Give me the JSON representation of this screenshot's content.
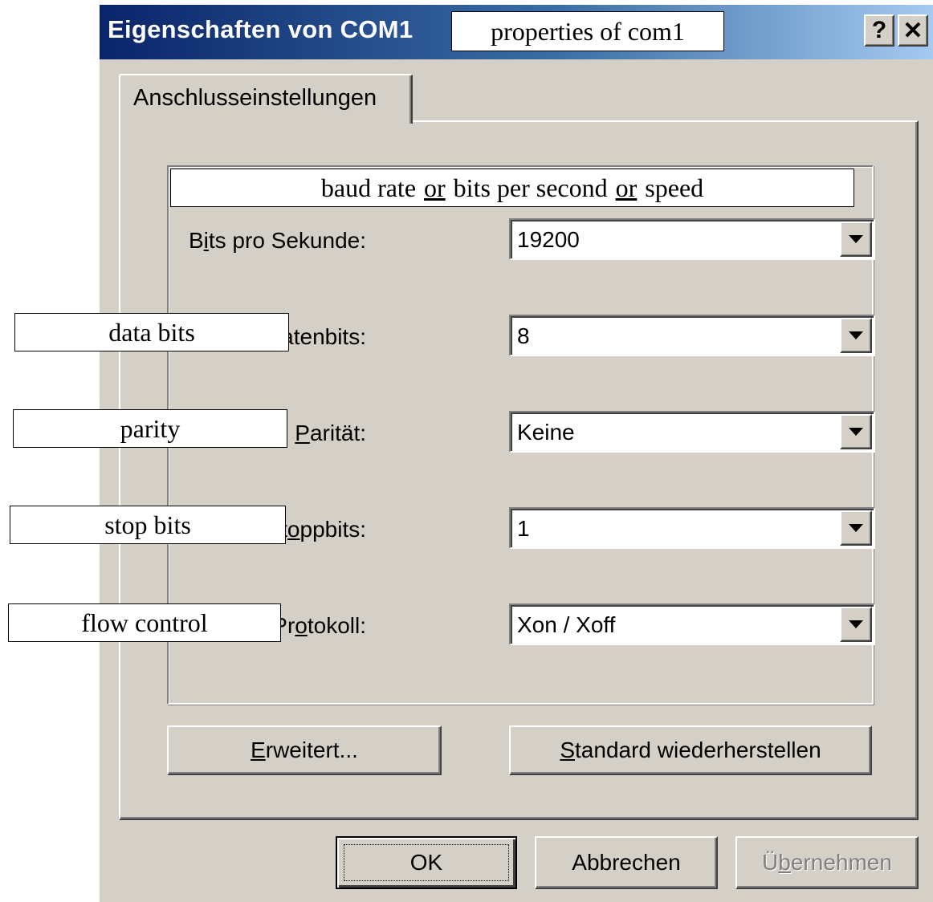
{
  "dialog": {
    "title": "Eigenschaften von COM1",
    "help_button": "?",
    "close_button": "✕",
    "tab_label": "Anschlusseinstellungen"
  },
  "fields": [
    {
      "label_pre": "B",
      "label_key": "i",
      "label_post": "ts pro Sekunde:",
      "value": "19200"
    },
    {
      "label_pre": "",
      "label_key": "D",
      "label_post": "atenbits:",
      "value": "8"
    },
    {
      "label_pre": "",
      "label_key": "P",
      "label_post": "arität:",
      "value": "Keine"
    },
    {
      "label_pre": "St",
      "label_key": "o",
      "label_post": "ppbits:",
      "value": "1"
    },
    {
      "label_pre": "Pr",
      "label_key": "o",
      "label_post": "tokoll:",
      "value": "Xon / Xoff"
    }
  ],
  "panel_buttons": {
    "advanced": {
      "pre": "",
      "key": "E",
      "post": "rweitert..."
    },
    "restore": {
      "pre": "",
      "key": "S",
      "post": "tandard wiederherstellen"
    }
  },
  "footer_buttons": {
    "ok": "OK",
    "cancel": "Abbrechen",
    "apply": {
      "pre": "Ü",
      "key": "b",
      "post": "ernehmen"
    }
  },
  "annotations": {
    "title": "properties of com1",
    "baud_a": "baud rate",
    "baud_or1": "or",
    "baud_b": "bits per second",
    "baud_or2": "or",
    "baud_c": "speed",
    "data_bits": "data bits",
    "parity": "parity",
    "stop_bits": "stop bits",
    "flow_control": "flow control"
  },
  "colors": {
    "face": "#d4d0c8",
    "title_start": "#0a246a",
    "title_end": "#a6caf0"
  }
}
